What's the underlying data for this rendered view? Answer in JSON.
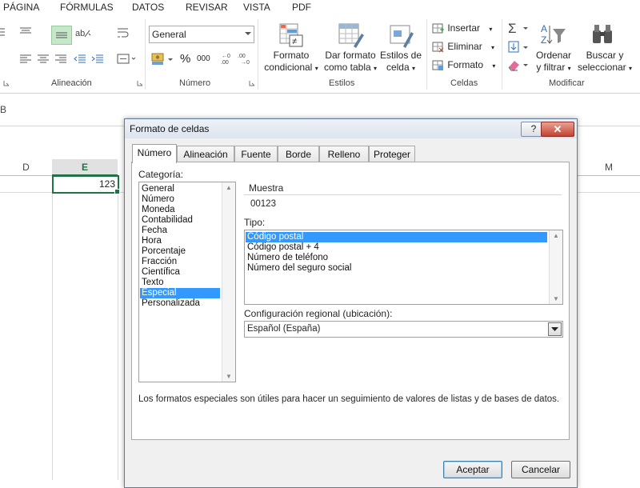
{
  "menu_tabs": [
    "PÁGINA",
    "FÓRMULAS",
    "DATOS",
    "REVISAR",
    "VISTA",
    "PDF"
  ],
  "ribbon": {
    "groups": {
      "alignment": "Alineación",
      "number": "Número",
      "styles": "Estilos",
      "cells": "Celdas",
      "modify": "Modificar"
    },
    "number_format_value": "General",
    "percent_symbol": "%",
    "thousands_symbol": "000",
    "conditional_format_line1": "Formato",
    "conditional_format_line2": "condicional",
    "format_table_line1": "Dar formato",
    "format_table_line2": "como tabla",
    "cell_styles_line1": "Estilos de",
    "cell_styles_line2": "celda",
    "insert_label": "Insertar",
    "delete_label": "Eliminar",
    "format_label": "Formato",
    "sort_filter_line1": "Ordenar",
    "sort_filter_line2": "y filtrar",
    "find_select_line1": "Buscar y",
    "find_select_line2": "seleccionar"
  },
  "formula_bar_fragment": "B",
  "sheet": {
    "columns": [
      "D",
      "E",
      "M"
    ],
    "cell_e_value": "123"
  },
  "dialog": {
    "title": "Formato de celdas",
    "help_label": "?",
    "close_label": "✕",
    "tabs": [
      "Número",
      "Alineación",
      "Fuente",
      "Borde",
      "Relleno",
      "Proteger"
    ],
    "category_label": "Categoría:",
    "categories": [
      "General",
      "Número",
      "Moneda",
      "Contabilidad",
      "Fecha",
      "Hora",
      "Porcentaje",
      "Fracción",
      "Científica",
      "Texto",
      "Especial",
      "Personalizada"
    ],
    "selected_category": "Especial",
    "sample_label": "Muestra",
    "sample_value": "00123",
    "type_label": "Tipo:",
    "types": [
      "Código postal",
      "Código postal + 4",
      "Número de teléfono",
      "Número del seguro social"
    ],
    "selected_type": "Código postal",
    "locale_label": "Configuración regional (ubicación):",
    "locale_value": "Español (España)",
    "description": "Los formatos especiales son útiles para hacer un seguimiento de valores de listas y de bases de datos.",
    "ok_label": "Aceptar",
    "cancel_label": "Cancelar"
  },
  "colors": {
    "selection": "#3399ff",
    "accent_green": "#217346",
    "close_red": "#c4432f"
  },
  "icons": [
    "sigma-icon",
    "sort-az-icon",
    "binoculars-icon",
    "conditional-format-icon",
    "format-table-icon",
    "cell-styles-icon",
    "insert-cells-icon",
    "delete-cells-icon",
    "format-cells-icon",
    "fill-down-icon",
    "eraser-icon",
    "currency-icon"
  ]
}
